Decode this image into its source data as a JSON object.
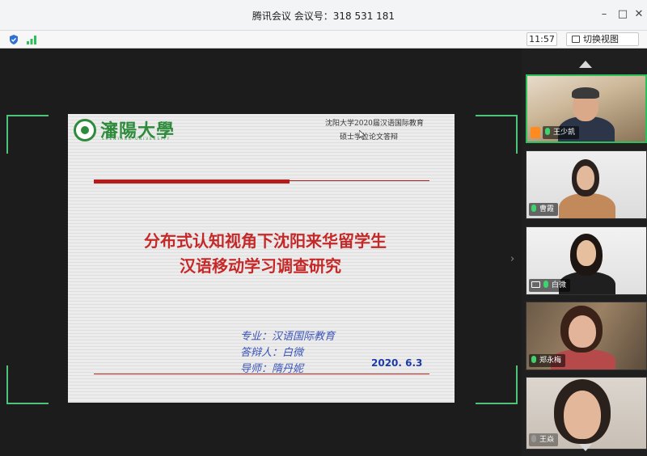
{
  "window": {
    "title": "腾讯会议 会议号：318 531 181",
    "minimize_label": "–",
    "maximize_label": "□",
    "close_label": "✕"
  },
  "toolbar": {
    "time": "11:57",
    "switch_view_label": "切换视图",
    "icons": [
      "shield-icon",
      "signal-icon"
    ]
  },
  "colors": {
    "accent_green": "#2fbf5a",
    "slide_title_red": "#c62828",
    "slide_info_blue": "#3a53b8"
  },
  "slide": {
    "university_logo_text": "瀋陽大學",
    "university_logo_sub": "SHENYANG UNIVERSITY",
    "header_line1": "沈阳大学2020届汉语国际教育",
    "header_line2": "硕士学位论文答辩",
    "title_line1": "分布式认知视角下沈阳来华留学生",
    "title_line2": "汉语移动学习调查研究",
    "major": "专业：汉语国际教育",
    "defender": "答辩人：白微",
    "advisor": "导师：隋丹妮",
    "date": "2020. 6.3"
  },
  "participants": [
    {
      "name": "王少凯",
      "host": true
    },
    {
      "name": "曹霞",
      "host": false
    },
    {
      "name": "白微",
      "host": false,
      "sharing": true
    },
    {
      "name": "郑永梅",
      "host": false
    },
    {
      "name": "王焱",
      "host": false
    }
  ]
}
